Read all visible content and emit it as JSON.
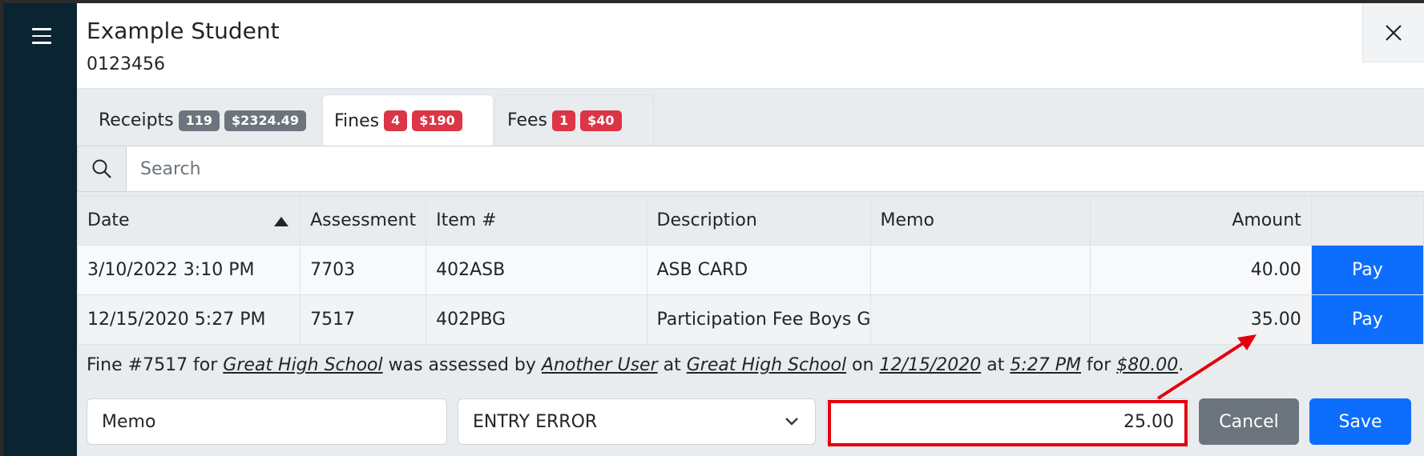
{
  "student": {
    "name": "Example Student",
    "id": "0123456"
  },
  "tabs": [
    {
      "label": "Receipts",
      "count": "119",
      "total": "$2324.49"
    },
    {
      "label": "Fines",
      "count": "4",
      "total": "$190"
    },
    {
      "label": "Fees",
      "count": "1",
      "total": "$40"
    }
  ],
  "search": {
    "placeholder": "Search"
  },
  "table": {
    "headers": {
      "date": "Date",
      "assessment": "Assessment",
      "item": "Item #",
      "description": "Description",
      "memo": "Memo",
      "amount": "Amount"
    },
    "rows": [
      {
        "date": "3/10/2022 3:10 PM",
        "assessment": "7703",
        "item": "402ASB",
        "description": "ASB CARD",
        "memo": "",
        "amount": "40.00",
        "action": "Pay"
      },
      {
        "date": "12/15/2020 5:27 PM",
        "assessment": "7517",
        "item": "402PBG",
        "description": "Participation Fee Boys Go",
        "memo": "",
        "amount": "35.00",
        "action": "Pay"
      }
    ]
  },
  "detail": {
    "prefix": "Fine #7517 for ",
    "school": "Great High School",
    "assessed_by_text": " was assessed by ",
    "user": "Another User",
    "at_text": " at ",
    "location": "Great High School",
    "on_text": " on ",
    "date": "12/15/2020",
    "at_time_text": " at ",
    "time": "5:27 PM",
    "for_text": " for ",
    "amount": "$80.00",
    "suffix": "."
  },
  "edit_form": {
    "memo_value": "Memo",
    "reason_value": "ENTRY ERROR",
    "amount_value": "25.00",
    "cancel_label": "Cancel",
    "save_label": "Save"
  },
  "colors": {
    "sidebar": "#0b2431",
    "primary": "#0d6efd",
    "danger_badge": "#dc3545",
    "annotation": "#e3000f"
  }
}
